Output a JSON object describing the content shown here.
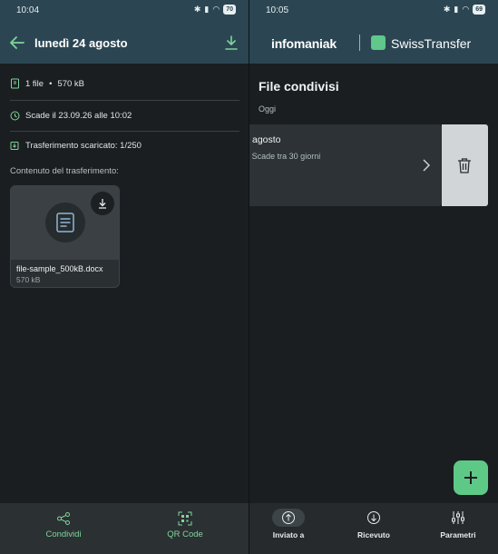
{
  "left": {
    "status": {
      "time": "10:04",
      "battery": "70"
    },
    "header": {
      "title": "lunedì 24 agosto"
    },
    "info": {
      "files": "1 file",
      "dot": "•",
      "size": "570 kB",
      "expiry": "Scade il 23.09.26 alle 10:02",
      "downloaded": "Trasferimento scaricato: 1/250"
    },
    "section_label": "Contenuto del trasferimento:",
    "file": {
      "name": "file-sample_500kB.docx",
      "size": "570 kB"
    },
    "bottom": {
      "share_label": "Condividi",
      "qr_label": "QR Code"
    }
  },
  "right": {
    "status": {
      "time": "10:05",
      "battery": "69"
    },
    "brand": {
      "infomaniak": "infomaniak",
      "app": "SwissTransfer"
    },
    "heading": "File condivisi",
    "group": "Oggi",
    "item": {
      "title": "agosto",
      "subtitle": "• Scade tra 30 giorni"
    },
    "nav": {
      "sent": "Inviato a",
      "received": "Ricevuto",
      "settings": "Parametri"
    }
  },
  "colors": {
    "accent": "#5ec986",
    "header": "#2b4652",
    "background": "#1b1e20"
  }
}
